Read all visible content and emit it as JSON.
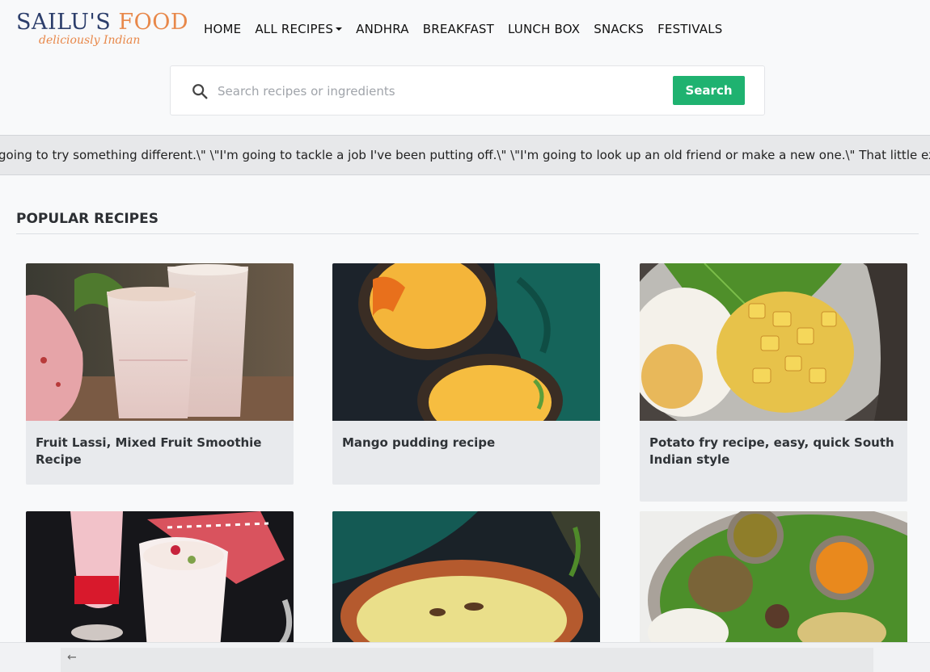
{
  "brand": {
    "name_part1": "SAILU'S",
    "name_part2": "FOOD",
    "tagline": "deliciously Indian"
  },
  "nav": {
    "items": [
      {
        "label": "HOME"
      },
      {
        "label": "ALL RECIPES",
        "has_dropdown": true
      },
      {
        "label": "ANDHRA"
      },
      {
        "label": "BREAKFAST"
      },
      {
        "label": "LUNCH BOX"
      },
      {
        "label": "SNACKS"
      },
      {
        "label": "FESTIVALS"
      }
    ]
  },
  "search": {
    "placeholder": "Search recipes or ingredients",
    "value": "",
    "button_label": "Search"
  },
  "ticker": {
    "text": "going to try something different.\\\" \\\"I'm going to tackle a job I've been putting off.\\\" \\\"I'm going to look up an old friend or make a new one.\\\" That little extra effort"
  },
  "popular": {
    "heading": "POPULAR RECIPES",
    "cards": [
      {
        "title": "Fruit Lassi, Mixed Fruit Smoothie Recipe",
        "image": "fruit-lassi-photo"
      },
      {
        "title": "Mango pudding recipe",
        "image": "mango-pudding-photo"
      },
      {
        "title": "Potato fry recipe, easy, quick South Indian style",
        "image": "potato-fry-photo"
      },
      {
        "title": "",
        "image": "falooda-photo"
      },
      {
        "title": "",
        "image": "kheer-photo"
      },
      {
        "title": "",
        "image": "thali-photo"
      }
    ]
  },
  "footer": {
    "back_icon": "left-arrow-icon"
  },
  "colors": {
    "accent": "#1fb270",
    "brand_dark": "#2c3e6b",
    "brand_orange": "#e8884a",
    "card_bg": "#e8eaed"
  }
}
